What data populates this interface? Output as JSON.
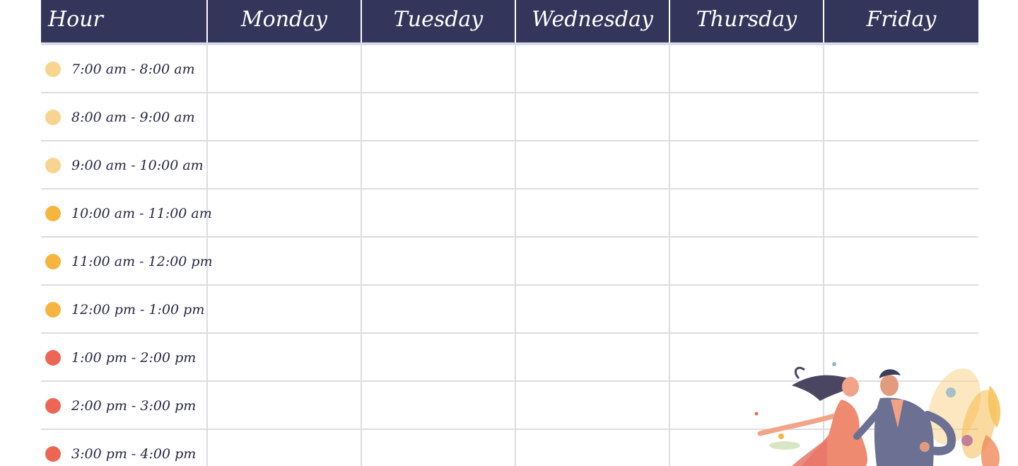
{
  "header": {
    "hour": "Hour",
    "days": [
      "Monday",
      "Tuesday",
      "Wednesday",
      "Thursday",
      "Friday"
    ]
  },
  "colors": {
    "header_bg": "#33365a",
    "light_yellow": "#f9d48e",
    "orange": "#f6b53f",
    "red": "#ee6554",
    "grid_line": "#dcdde2"
  },
  "slots": [
    {
      "time": "7:00 am - 8:00 am",
      "dot_color": "#f9d48e"
    },
    {
      "time": "8:00 am - 9:00 am",
      "dot_color": "#f9d48e"
    },
    {
      "time": "9:00 am - 10:00 am",
      "dot_color": "#f9d48e"
    },
    {
      "time": "10:00 am - 11:00 am",
      "dot_color": "#f6b53f"
    },
    {
      "time": "11:00 am - 12:00 pm",
      "dot_color": "#f6b53f"
    },
    {
      "time": "12:00 pm - 1:00 pm",
      "dot_color": "#f6b53f"
    },
    {
      "time": "1:00 pm - 2:00 pm",
      "dot_color": "#ee6554"
    },
    {
      "time": "2:00 pm - 3:00 pm",
      "dot_color": "#ee6554"
    },
    {
      "time": "3:00 pm - 4:00 pm",
      "dot_color": "#ee6554"
    }
  ],
  "illustration": {
    "name": "dancing-couple-illustration"
  }
}
